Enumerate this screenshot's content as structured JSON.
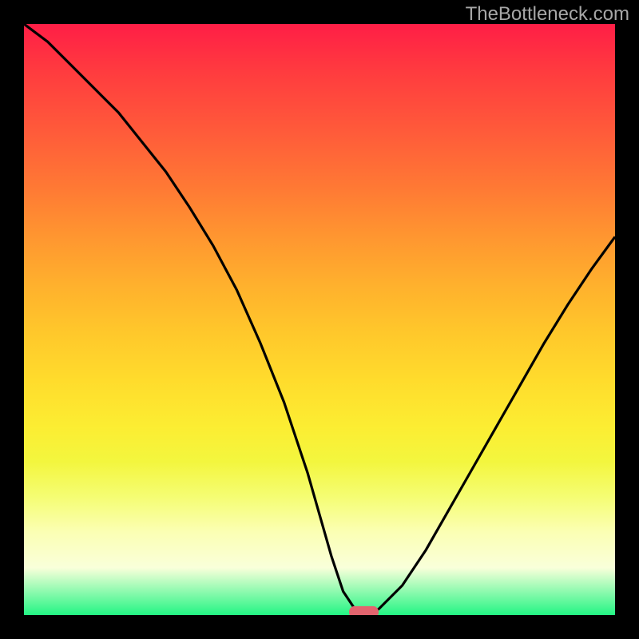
{
  "watermark": "TheBottleneck.com",
  "chart_data": {
    "type": "line",
    "title": "",
    "xlabel": "",
    "ylabel": "",
    "xlim": [
      0,
      100
    ],
    "ylim": [
      0,
      100
    ],
    "x": [
      0,
      4,
      8,
      12,
      16,
      20,
      24,
      28,
      32,
      36,
      40,
      44,
      48,
      50,
      52,
      54,
      56,
      58,
      60,
      64,
      68,
      72,
      76,
      80,
      84,
      88,
      92,
      96,
      100
    ],
    "values": [
      100,
      97,
      93,
      89,
      85,
      80,
      75,
      69,
      62.5,
      55,
      46,
      36,
      24,
      17,
      10,
      4,
      1,
      0,
      1,
      5,
      11,
      18,
      25,
      32,
      39,
      46,
      52.5,
      58.5,
      64
    ],
    "background_gradient": [
      "#ff1e46",
      "#ffdf2d",
      "#23f584"
    ],
    "marker": {
      "x_center": 57.5,
      "y": 0.5,
      "width": 5,
      "height": 2,
      "color": "#e2646e"
    }
  }
}
